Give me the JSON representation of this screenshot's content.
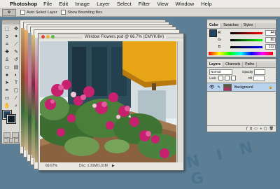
{
  "menubar": {
    "app": "Photoshop",
    "items": [
      "File",
      "Edit",
      "Image",
      "Layer",
      "Select",
      "Filter",
      "View",
      "Window",
      "Help"
    ]
  },
  "options_bar": {
    "auto_select_label": "Auto Select Layer",
    "show_bounding_label": "Show Bounding Box"
  },
  "document": {
    "title": "Window Flowers.psd @ 66.7% (CMYK/8#)",
    "zoom": "66.67%",
    "doc_size": "Doc: 1.31M/1.31M"
  },
  "color_panel": {
    "tabs": [
      "Color",
      "Swatches",
      "Styles"
    ],
    "channels": [
      {
        "label": "R",
        "value": "44"
      },
      {
        "label": "G",
        "value": "80"
      },
      {
        "label": "B",
        "value": "132"
      }
    ]
  },
  "layers_panel": {
    "tabs": [
      "Layers",
      "Channels",
      "Paths"
    ],
    "blend_mode": "Normal",
    "opacity_label": "Opacity",
    "fill_label": "Fill",
    "lock_label": "Lock",
    "layer_name": "Background"
  },
  "watermark": "N I N G",
  "colors": {
    "desktop": "#5d7f96",
    "foreground": "#23425d",
    "selected_layer": "#b9d3ee"
  }
}
